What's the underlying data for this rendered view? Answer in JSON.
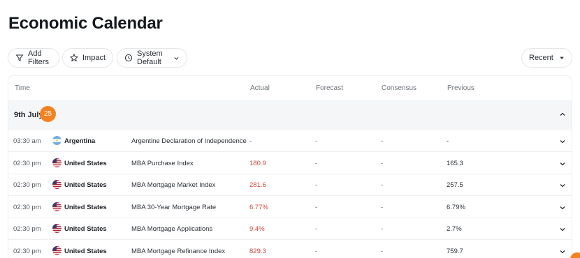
{
  "page": {
    "title": "Economic Calendar"
  },
  "filters": {
    "add_filters": "Add Filters",
    "impact": "Impact",
    "timezone": "System Default",
    "sort": "Recent"
  },
  "table": {
    "headers": {
      "time": "Time",
      "actual": "Actual",
      "forecast": "Forecast",
      "consensus": "Consensus",
      "previous": "Previous"
    },
    "group": {
      "date": "9th July",
      "badge": "25"
    },
    "rows": [
      {
        "time": "03:30 am",
        "flag": "argentina-flag-icon",
        "country": "Argentina",
        "event": "Argentine Declaration of Independence",
        "actual": "-",
        "forecast": "-",
        "consensus": "-",
        "previous": "-"
      },
      {
        "time": "02:30 pm",
        "flag": "us-flag-icon",
        "country": "United States",
        "event": "MBA Purchase Index",
        "actual": "180.9",
        "forecast": "-",
        "consensus": "-",
        "previous": "165.3"
      },
      {
        "time": "02:30 pm",
        "flag": "us-flag-icon",
        "country": "United States",
        "event": "MBA Mortgage Market Index",
        "actual": "281.6",
        "forecast": "-",
        "consensus": "-",
        "previous": "257.5"
      },
      {
        "time": "02:30 pm",
        "flag": "us-flag-icon",
        "country": "United States",
        "event": "MBA 30-Year Mortgage Rate",
        "actual": "6.77%",
        "forecast": "-",
        "consensus": "-",
        "previous": "6.79%"
      },
      {
        "time": "02:30 pm",
        "flag": "us-flag-icon",
        "country": "United States",
        "event": "MBA Mortgage Applications",
        "actual": "9.4%",
        "forecast": "-",
        "consensus": "-",
        "previous": "2.7%"
      },
      {
        "time": "02:30 pm",
        "flag": "us-flag-icon",
        "country": "United States",
        "event": "MBA Mortgage Refinance Index",
        "actual": "829.3",
        "forecast": "-",
        "consensus": "-",
        "previous": "759.7"
      }
    ]
  },
  "colors": {
    "accent": "#f58220",
    "actual_value": "#d0463a",
    "group_bg": "#f5f6f8",
    "border": "#eceef1"
  }
}
